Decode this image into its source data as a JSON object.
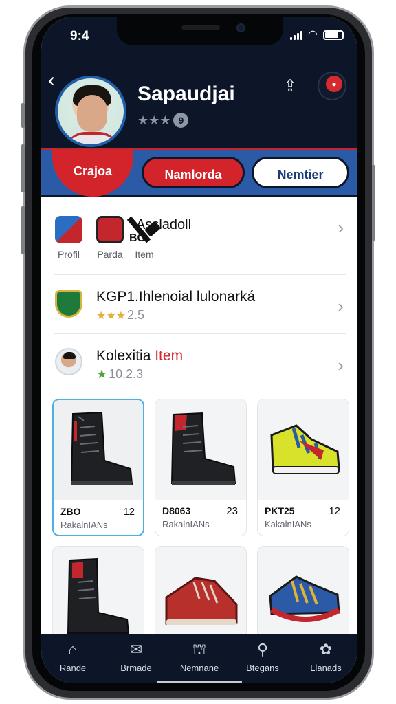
{
  "status_bar": {
    "time": "9:4"
  },
  "header": {
    "profile_name": "Sapaudjai",
    "rating_stars": "★★★",
    "rating_badge": "9",
    "tabs": [
      {
        "label": "Crajoa"
      },
      {
        "label": "Namlorda"
      },
      {
        "label": "Nemtier"
      }
    ]
  },
  "category_row": {
    "items": [
      {
        "label": "Profil",
        "icon": "shield-tool-icon"
      },
      {
        "label": "Parda",
        "icon": "red-badge-icon"
      },
      {
        "label": "Item",
        "icon": "tools-icon"
      }
    ],
    "title": "Assladoll",
    "code": "BO"
  },
  "list_items": [
    {
      "title": "KGP1.Ihlenoial lulonarká",
      "accent": "",
      "rating_text": "2.5",
      "icon": "club-shield-icon"
    },
    {
      "title": "Kolexitia ",
      "accent": "Item",
      "rating_text": "10.2.3",
      "icon": "player-avatar-icon"
    }
  ],
  "products": [
    {
      "code": "ZBO",
      "qty": "12",
      "subtitle": "RakalnIANs",
      "selected": true,
      "image": "black-boot"
    },
    {
      "code": "D8063",
      "qty": "23",
      "subtitle": "RakalnIANs",
      "selected": false,
      "image": "black-red-boot"
    },
    {
      "code": "PKT25",
      "qty": "12",
      "subtitle": "KakalnIANs",
      "selected": false,
      "image": "yellow-sneaker"
    },
    {
      "code": "",
      "qty": "",
      "subtitle": "",
      "selected": false,
      "image": "black-tall-boot"
    },
    {
      "code": "",
      "qty": "",
      "subtitle": "",
      "selected": false,
      "image": "red-shoe"
    },
    {
      "code": "",
      "qty": "",
      "subtitle": "",
      "selected": false,
      "image": "colorful-sneaker"
    }
  ],
  "bottom_nav": [
    {
      "label": "Rande",
      "icon": "home-icon"
    },
    {
      "label": "Brmade",
      "icon": "message-icon"
    },
    {
      "label": "Nemnane",
      "icon": "shop-icon"
    },
    {
      "label": "Btegans",
      "icon": "search-icon"
    },
    {
      "label": "Llanads",
      "icon": "profile-flower-icon"
    }
  ],
  "colors": {
    "header_bg": "#0c1628",
    "accent_red": "#d4242b",
    "accent_blue": "#2b5ba6",
    "selected_border": "#4ab0e6"
  }
}
